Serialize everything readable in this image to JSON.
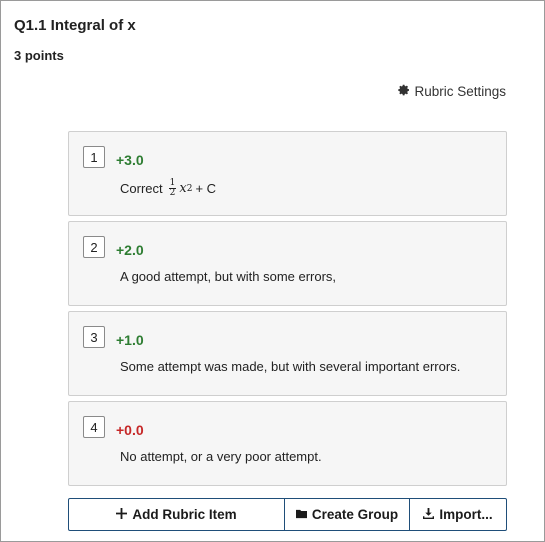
{
  "question": {
    "title": "Q1.1 Integral of x",
    "points": "3 points"
  },
  "rubric_settings": {
    "label": "Rubric Settings",
    "icon": "gear-icon"
  },
  "rubric_items": [
    {
      "key": "1",
      "points": "+3.0",
      "desc_prefix": "Correct",
      "desc_suffix": "+ C",
      "math": {
        "num": "1",
        "den": "2",
        "var": "x",
        "exp": "2"
      },
      "color": "#2e7d32"
    },
    {
      "key": "2",
      "points": "+2.0",
      "desc": "A good attempt, but with some errors,",
      "color": "#2e7d32"
    },
    {
      "key": "3",
      "points": "+1.0",
      "desc": "Some attempt was made, but with several important errors.",
      "color": "#2e7d32"
    },
    {
      "key": "4",
      "points": "+0.0",
      "desc": "No attempt, or a very poor attempt.",
      "color": "#c62828"
    }
  ],
  "actions": {
    "add_label": "Add Rubric Item",
    "create_label": "Create Group",
    "import_label": "Import..."
  }
}
